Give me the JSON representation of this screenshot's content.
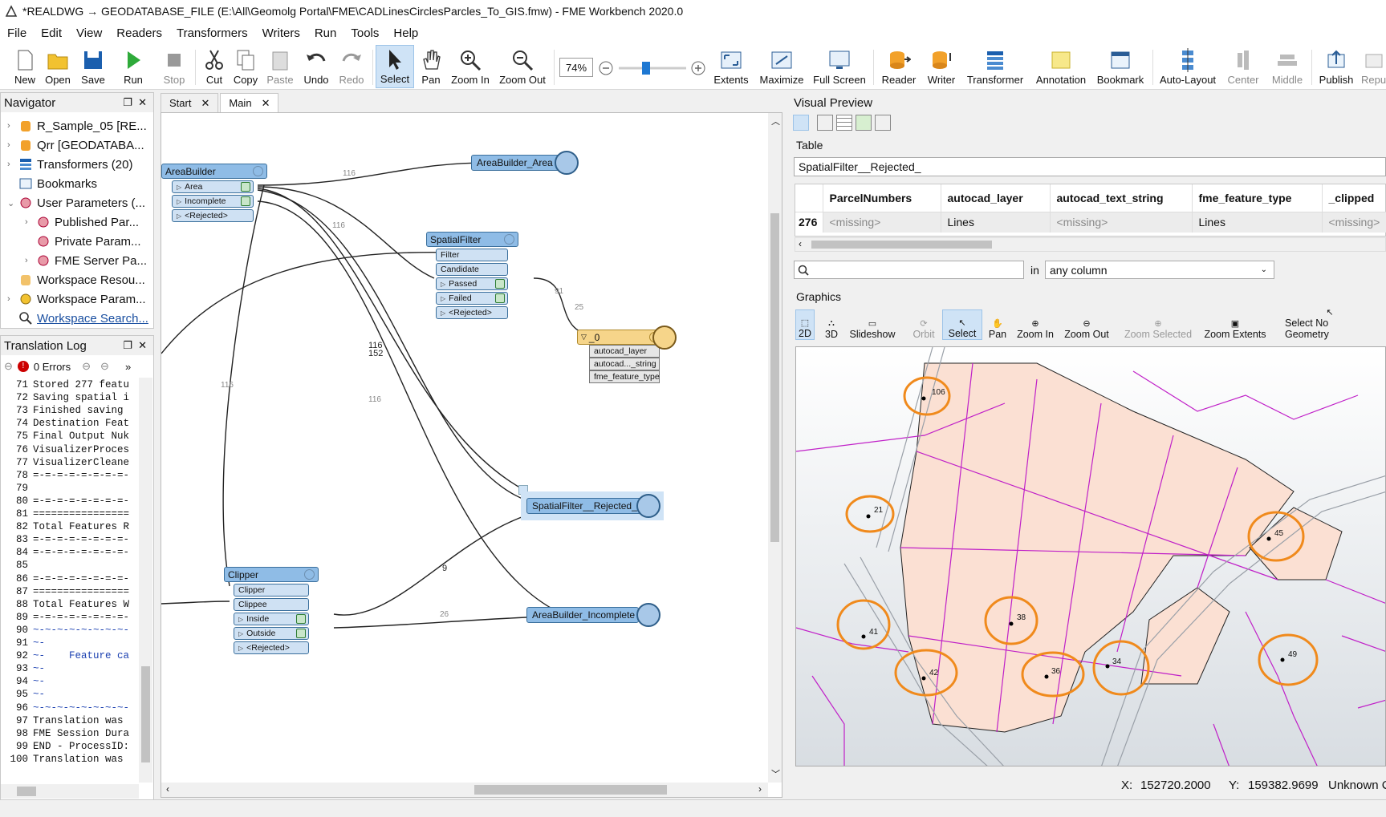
{
  "window": {
    "title": "*REALDWG → GEODATABASE_FILE (E:\\All\\Geomolg Portal\\FME\\CADLinesCirclesParcles_To_GIS.fmw) - FME Workbench 2020.0"
  },
  "menu": [
    "File",
    "Edit",
    "View",
    "Readers",
    "Transformers",
    "Writers",
    "Run",
    "Tools",
    "Help"
  ],
  "toolbar": {
    "new": "New",
    "open": "Open",
    "save": "Save",
    "run": "Run",
    "stop": "Stop",
    "cut": "Cut",
    "copy": "Copy",
    "paste": "Paste",
    "undo": "Undo",
    "redo": "Redo",
    "select": "Select",
    "pan": "Pan",
    "zoom_in": "Zoom In",
    "zoom_out": "Zoom Out",
    "zoom_level": "74%",
    "extents": "Extents",
    "maximize": "Maximize",
    "full_screen": "Full Screen",
    "reader": "Reader",
    "writer": "Writer",
    "transformer": "Transformer",
    "annotation": "Annotation",
    "bookmark": "Bookmark",
    "auto_layout": "Auto-Layout",
    "center": "Center",
    "middle": "Middle",
    "publish": "Publish",
    "republish": "Repu"
  },
  "navigator": {
    "title": "Navigator",
    "items": [
      "R_Sample_05 [RE...",
      "Qrr [GEODATABA...",
      "Transformers (20)",
      "Bookmarks",
      "User Parameters (...",
      "Published Par...",
      "Private Param...",
      "FME Server Pa...",
      "Workspace Resou...",
      "Workspace Param...",
      "Workspace Search..."
    ]
  },
  "translation_log": {
    "title": "Translation Log",
    "errors": "0 Errors",
    "lines": [
      {
        "n": "71",
        "t": "Stored 277 featu"
      },
      {
        "n": "72",
        "t": "Saving spatial i"
      },
      {
        "n": "73",
        "t": "Finished saving"
      },
      {
        "n": "74",
        "t": "Destination Feat"
      },
      {
        "n": "75",
        "t": "Final Output Nuk"
      },
      {
        "n": "76",
        "t": "VisualizerProces"
      },
      {
        "n": "77",
        "t": "VisualizerCleane"
      },
      {
        "n": "78",
        "t": "=-=-=-=-=-=-=-=-"
      },
      {
        "n": "79",
        "t": ""
      },
      {
        "n": "80",
        "t": "=-=-=-=-=-=-=-=-"
      },
      {
        "n": "81",
        "t": "================"
      },
      {
        "n": "82",
        "t": "Total Features R"
      },
      {
        "n": "83",
        "t": "=-=-=-=-=-=-=-=-"
      },
      {
        "n": "84",
        "t": "=-=-=-=-=-=-=-=-"
      },
      {
        "n": "85",
        "t": ""
      },
      {
        "n": "86",
        "t": "=-=-=-=-=-=-=-=-"
      },
      {
        "n": "87",
        "t": "================"
      },
      {
        "n": "88",
        "t": "Total Features W"
      },
      {
        "n": "89",
        "t": "=-=-=-=-=-=-=-=-"
      },
      {
        "n": "90",
        "t": "~-~-~-~-~-~-~-~-"
      },
      {
        "n": "91",
        "t": "~-"
      },
      {
        "n": "92",
        "t": "~-    Feature ca"
      },
      {
        "n": "93",
        "t": "~-"
      },
      {
        "n": "94",
        "t": "~-"
      },
      {
        "n": "95",
        "t": "~-"
      },
      {
        "n": "96",
        "t": "~-~-~-~-~-~-~-~-"
      },
      {
        "n": "97",
        "t": "Translation was"
      },
      {
        "n": "98",
        "t": "FME Session Dura"
      },
      {
        "n": "99",
        "t": "END - ProcessID:"
      },
      {
        "n": "100",
        "t": "Translation was"
      }
    ]
  },
  "tabs": [
    {
      "label": "Start"
    },
    {
      "label": "Main"
    }
  ],
  "canvas": {
    "area_builder": {
      "title": "AreaBuilder",
      "ports": [
        "Area",
        "Incomplete",
        "<Rejected>"
      ]
    },
    "spatial_filter": {
      "title": "SpatialFilter",
      "inputs": [
        "Filter",
        "Candidate"
      ],
      "outputs": [
        "Passed",
        "Failed",
        "<Rejected>"
      ]
    },
    "clipper": {
      "title": "Clipper",
      "inputs": [
        "Clipper",
        "Clippee"
      ],
      "outputs": [
        "Inside",
        "Outside",
        "<Rejected>"
      ]
    },
    "writer": {
      "title": "_0",
      "attrs": [
        "autocad_layer",
        "autocad..._string",
        "fme_feature_type"
      ]
    },
    "inspectors": [
      "AreaBuilder_Area",
      "SpatialFilter__Rejected_",
      "AreaBuilder_Incomplete"
    ],
    "counts": {
      "c116a": "116",
      "c116b": "116",
      "c116c": "116",
      "c116d": "116",
      "c152": "152",
      "c116e": "116",
      "c91": "91",
      "c25": "25",
      "c9": "9",
      "c26": "26"
    }
  },
  "visual_preview": {
    "title": "Visual Preview",
    "table_label": "Table",
    "table_name": "SpatialFilter__Rejected_",
    "columns": [
      "ParcelNumbers",
      "autocad_layer",
      "autocad_text_string",
      "fme_feature_type",
      "_clipped"
    ],
    "row": {
      "id": "276",
      "cells": [
        "<missing>",
        "Lines",
        "<missing>",
        "Lines",
        "<missing>"
      ]
    },
    "search_in": "in",
    "search_scope": "any column",
    "graphics_label": "Graphics",
    "gfx_buttons": [
      "2D",
      "3D",
      "Slideshow",
      "Orbit",
      "Select",
      "Pan",
      "Zoom In",
      "Zoom Out",
      "Zoom Selected",
      "Zoom Extents",
      "Select No Geometry"
    ],
    "parcels": [
      "106",
      "21",
      "45",
      "41",
      "38",
      "42",
      "36",
      "34",
      "49"
    ],
    "status": {
      "x_label": "X:",
      "x": "152720.2000",
      "y_label": "Y:",
      "y": "159382.9699",
      "crs": "Unknown Coordi"
    }
  },
  "colors": {
    "accent": "#8fbce6",
    "writer": "#f6d58a",
    "parcel": "#fbe0d3",
    "line": "#c020c8",
    "circle": "#f08a1c"
  }
}
